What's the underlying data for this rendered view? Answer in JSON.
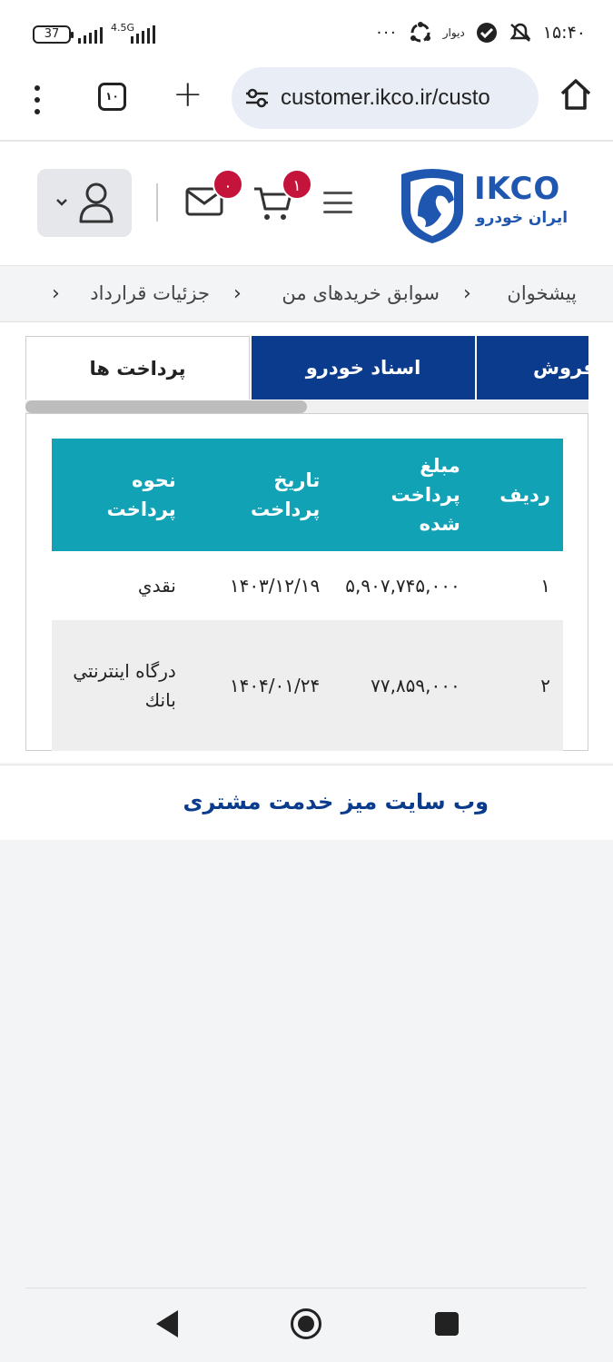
{
  "status_bar": {
    "battery": "37",
    "network": "4.5G",
    "app_label": "دیوار",
    "dots": "···",
    "time": "۱۵:۴۰"
  },
  "browser": {
    "tab_count": "۱۰",
    "url": "customer.ikco.ir/custo"
  },
  "header": {
    "mail_badge": "۰",
    "cart_badge": "۱",
    "logo_text": "IKCO",
    "logo_subtext": "ایران خودرو"
  },
  "breadcrumb": {
    "items": [
      "پیشخوان",
      "سوابق خریدهای من",
      "جزئیات قرارداد"
    ]
  },
  "tabs": {
    "payments": "پرداخت ها",
    "car_docs": "اسناد خودرو",
    "sales": "فروش"
  },
  "table": {
    "headers": {
      "index": "ردیف",
      "amount": "مبلغ پرداخت شده",
      "date": "تاریخ پرداخت",
      "method": "نحوه پرداخت"
    },
    "rows": [
      {
        "index": "۱",
        "amount": "۵,۹۰۷,۷۴۵,۰۰۰",
        "date": "۱۴۰۳/۱۲/۱۹",
        "method": "نقدي"
      },
      {
        "index": "۲",
        "amount": "۷۷,۸۵۹,۰۰۰",
        "date": "۱۴۰۴/۰۱/۲۴",
        "method": "درگاه اینترنتي بانك"
      }
    ]
  },
  "footer": {
    "title": "وب سایت میز خدمت مشتری"
  },
  "colors": {
    "brand_blue": "#0b3b8c",
    "table_header": "#12a2b5",
    "badge_red": "#c4143c"
  }
}
